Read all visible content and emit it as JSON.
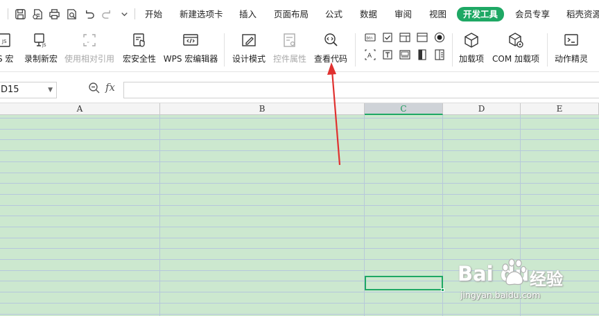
{
  "menu": {
    "tabs": [
      "开始",
      "新建选项卡",
      "插入",
      "页面布局",
      "公式",
      "数据",
      "审阅",
      "视图",
      "开发工具",
      "会员专享",
      "稻壳资源"
    ],
    "active_tab": "开发工具",
    "accent": "#1ea864"
  },
  "ribbon": {
    "buttons": [
      {
        "label": "JS 宏"
      },
      {
        "label": "录制新宏"
      },
      {
        "label": "使用相对引用"
      },
      {
        "label": "宏安全性"
      },
      {
        "label": "WPS 宏编辑器"
      },
      {
        "label": "设计模式"
      },
      {
        "label": "控件属性"
      },
      {
        "label": "查看代码"
      },
      {
        "label": "加载项"
      },
      {
        "label": "COM 加载项"
      },
      {
        "label": "动作精灵"
      }
    ],
    "controls": {
      "button_icon_text": "btn",
      "label_icon_text": "A"
    }
  },
  "formula_bar": {
    "name_box": "D15",
    "fx": "fx",
    "formula": ""
  },
  "sheet": {
    "columns": [
      "A",
      "B",
      "C",
      "D",
      "E"
    ],
    "selected_column": "C",
    "grid_color": "#cce8cf"
  },
  "watermark": {
    "brand": "Bai du",
    "cn": "经验",
    "url": "jingyan.baidu.com"
  }
}
